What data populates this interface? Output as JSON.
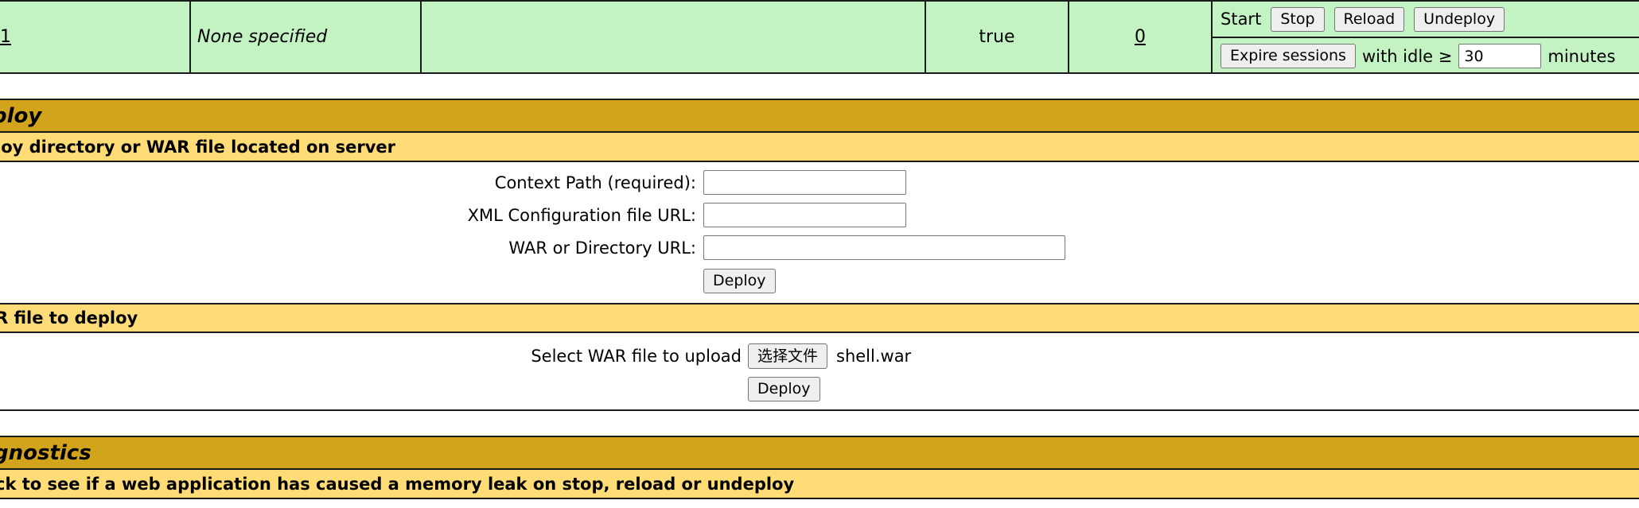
{
  "app_row": {
    "path_link": "1",
    "version": "None specified",
    "display_name": "",
    "running": "true",
    "sessions_link": "0",
    "commands": {
      "start_label": "Start",
      "stop_label": "Stop",
      "reload_label": "Reload",
      "undeploy_label": "Undeploy",
      "expire_label": "Expire sessions",
      "with_idle_label": "with idle ≥",
      "idle_value": "30",
      "minutes_label": "minutes"
    }
  },
  "deploy": {
    "title": "ploy",
    "server_section": {
      "title": "loy directory or WAR file located on server",
      "context_path_label": "Context Path (required):",
      "context_path_value": "",
      "xml_config_label": "XML Configuration file URL:",
      "xml_config_value": "",
      "war_dir_label": "WAR or Directory URL:",
      "war_dir_value": "",
      "deploy_label": "Deploy"
    },
    "upload_section": {
      "title": "R file to deploy",
      "select_label": "Select WAR file to upload",
      "choose_file_label": "选择文件",
      "chosen_file": "shell.war",
      "deploy_label": "Deploy"
    }
  },
  "diagnostics": {
    "title": "gnostics",
    "subtitle": "ck to see if a web application has caused a memory leak on stop, reload or undeploy"
  }
}
